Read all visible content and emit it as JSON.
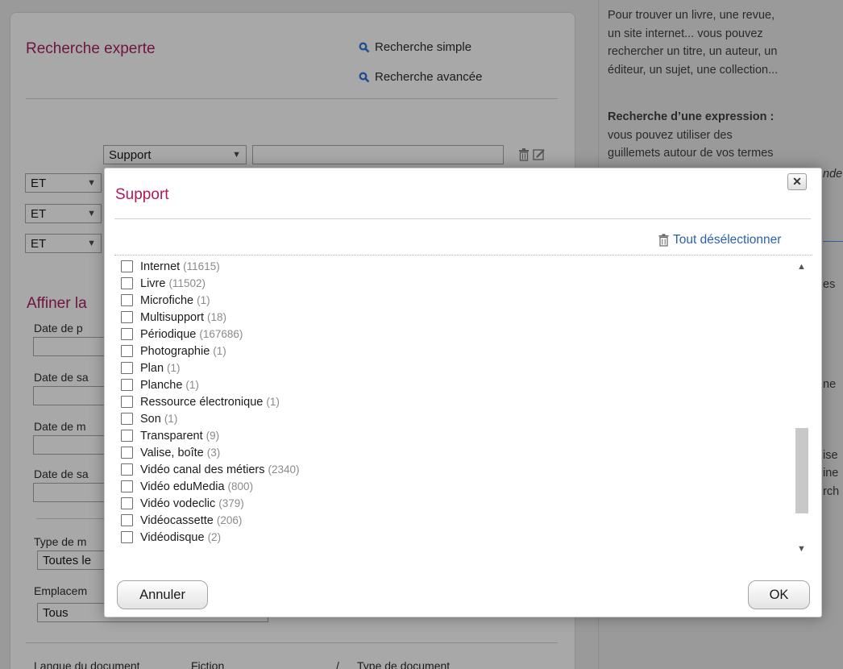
{
  "background": {
    "title": "Recherche experte",
    "links": {
      "simple": "Recherche simple",
      "advanced": "Recherche avancée"
    },
    "criteria_field": "Support",
    "operators": [
      "ET",
      "ET",
      "ET"
    ],
    "refine_title": "Affiner la",
    "date_labels": [
      "Date de p",
      "Date de sa",
      "Date de m",
      "Date de sa"
    ],
    "type_label": "Type de m",
    "type_value": "Toutes le",
    "location_label": "Emplacem",
    "location_value": "Tous",
    "bottom_labels": {
      "language": "Langue du document",
      "fiction": "Fiction",
      "slash": "/",
      "doc_type": "Type de document"
    },
    "help_lines": [
      "Pour trouver un livre, une revue,",
      "un site internet... vous pouvez",
      "rechercher un titre, un auteur, un",
      "éditeur, un sujet, une collection..."
    ],
    "help_bold": "Recherche d’une expression :",
    "help_lines2": [
      "vous pouvez utiliser  des",
      "guillemets autour de vos termes"
    ],
    "help_fragments": [
      "nde",
      "es",
      "ne",
      "ise",
      "ine",
      "rch"
    ]
  },
  "modal": {
    "title": "Support",
    "close_symbol": "✕",
    "deselect_all": "Tout désélectionner",
    "items": [
      {
        "label": "Internet",
        "count": "(11615)"
      },
      {
        "label": "Livre",
        "count": "(11502)"
      },
      {
        "label": "Microfiche",
        "count": "(1)"
      },
      {
        "label": "Multisupport",
        "count": "(18)"
      },
      {
        "label": "Périodique",
        "count": "(167686)"
      },
      {
        "label": "Photographie",
        "count": "(1)"
      },
      {
        "label": "Plan",
        "count": "(1)"
      },
      {
        "label": "Planche",
        "count": "(1)"
      },
      {
        "label": "Ressource électronique",
        "count": "(1)"
      },
      {
        "label": "Son",
        "count": "(1)"
      },
      {
        "label": "Transparent",
        "count": "(9)"
      },
      {
        "label": "Valise, boîte",
        "count": "(3)"
      },
      {
        "label": "Vidéo canal des métiers",
        "count": "(2340)"
      },
      {
        "label": "Vidéo eduMedia",
        "count": "(800)"
      },
      {
        "label": "Vidéo vodeclic",
        "count": "(379)"
      },
      {
        "label": "Vidéocassette",
        "count": "(206)"
      },
      {
        "label": "Vidéodisque",
        "count": "(2)"
      }
    ],
    "cancel_label": "Annuler",
    "ok_label": "OK"
  }
}
